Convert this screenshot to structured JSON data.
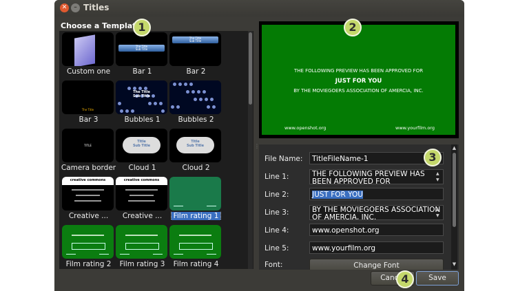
{
  "window": {
    "title": "Titles"
  },
  "choose_label": "Choose a Template",
  "templates": [
    {
      "label": "Custom one",
      "thumb": "custom"
    },
    {
      "label": "Bar 1",
      "thumb": "bar1",
      "thumb_text": [
        "The Title",
        "Sub Title"
      ]
    },
    {
      "label": "Bar 2",
      "thumb": "bar2",
      "thumb_text": [
        "The Title",
        "Sub Title"
      ]
    },
    {
      "label": "Bar 3",
      "thumb": "bar3",
      "thumb_text": [
        "The Title"
      ]
    },
    {
      "label": "Bubbles 1",
      "thumb": "bubbles1",
      "thumb_text": [
        "The Title",
        "Sub Title"
      ]
    },
    {
      "label": "Bubbles 2",
      "thumb": "bubbles2",
      "thumb_text": []
    },
    {
      "label": "Camera border",
      "thumb": "camera",
      "thumb_text": [
        "TITLE"
      ]
    },
    {
      "label": "Cloud 1",
      "thumb": "cloud1",
      "thumb_text": [
        "Title",
        "Sub Title"
      ]
    },
    {
      "label": "Cloud 2",
      "thumb": "cloud2",
      "thumb_text": [
        "Title",
        "Sub Title"
      ]
    },
    {
      "label": "Creative ...",
      "thumb": "cc1",
      "thumb_text": [
        "creative commons"
      ]
    },
    {
      "label": "Creative ...",
      "thumb": "cc2",
      "thumb_text": [
        "creative commons"
      ]
    },
    {
      "label": "Film rating 1",
      "thumb": "film1",
      "selected": true
    },
    {
      "label": "Film rating 2",
      "thumb": "film2"
    },
    {
      "label": "Film rating 3",
      "thumb": "film3"
    },
    {
      "label": "Film rating 4",
      "thumb": "film4"
    }
  ],
  "preview": {
    "line1": "THE FOLLOWING PREVIEW HAS BEEN APPROVED FOR",
    "line2": "JUST FOR YOU",
    "line3": "BY THE MOVIEGOERS ASSOCIATION OF AMERCIA, INC.",
    "line4": "www.openshot.org",
    "line5": "www.yourfilm.org"
  },
  "form": {
    "file_name_label": "File Name:",
    "file_name_value": "TitleFileName-1",
    "line1_label": "Line 1:",
    "line1_value": "THE FOLLOWING PREVIEW HAS BEEN APPROVED FOR",
    "line2_label": "Line 2:",
    "line2_value": "JUST FOR YOU",
    "line3_label": "Line 3:",
    "line3_value": "BY THE MOVIEGOERS ASSOCIATION OF AMERCIA, INC.",
    "line4_label": "Line 4:",
    "line4_value": "www.openshot.org",
    "line5_label": "Line 5:",
    "line5_value": "www.yourfilm.org",
    "font_label": "Font:",
    "change_font": "Change Font"
  },
  "buttons": {
    "cancel": "Cancel",
    "save": "Save"
  },
  "badges": [
    "1",
    "2",
    "3",
    "4"
  ],
  "colors": {
    "accent": "#3a6fc0",
    "preview_green": "#047b04",
    "badge": "#c4d86b"
  }
}
